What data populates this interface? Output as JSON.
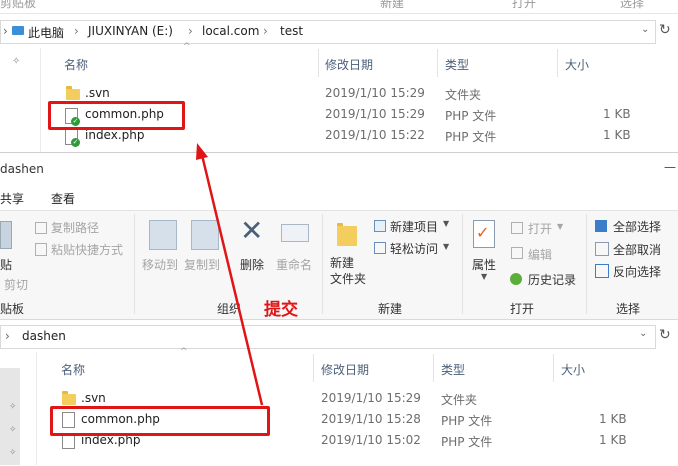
{
  "top_window": {
    "ribbon_tail": [
      "剪贴板",
      "新建",
      "打开",
      "选择"
    ],
    "breadcrumb": [
      "此电脑",
      "JIUXINYAN (E:)",
      "local.com",
      "test"
    ],
    "columns": [
      "名称",
      "修改日期",
      "类型",
      "大小"
    ],
    "files": [
      {
        "name": ".svn",
        "date": "2019/1/10 15:29",
        "type": "文件夹",
        "size": ""
      },
      {
        "name": "common.php",
        "date": "2019/1/10 15:29",
        "type": "PHP 文件",
        "size": "1 KB"
      },
      {
        "name": "index.php",
        "date": "2019/1/10 15:22",
        "type": "PHP 文件",
        "size": "1 KB"
      }
    ]
  },
  "bottom_window": {
    "title": "dashen",
    "tabs": [
      "共享",
      "查看"
    ],
    "ribbon": {
      "copy_path": "复制路径",
      "paste_shortcut": "粘贴快捷方式",
      "paste": "贴",
      "cut": "剪切",
      "clipboard_group": "贴板",
      "move_to": "移动到",
      "copy_to": "复制到",
      "delete": "删除",
      "rename": "重命名",
      "organize_group": "组织",
      "new_item": "新建项目",
      "easy_access": "轻松访问",
      "new_folder": "新建\n文件夹",
      "new_group": "新建",
      "properties": "属性",
      "open": "打开",
      "edit": "编辑",
      "history": "历史记录",
      "open_group": "打开",
      "select_all": "全部选择",
      "select_none": "全部取消",
      "invert_selection": "反向选择",
      "select_group": "选择"
    },
    "breadcrumb": [
      "dashen"
    ],
    "columns": [
      "名称",
      "修改日期",
      "类型",
      "大小"
    ],
    "files": [
      {
        "name": ".svn",
        "date": "2019/1/10 15:29",
        "type": "文件夹",
        "size": ""
      },
      {
        "name": "common.php",
        "date": "2019/1/10 15:28",
        "type": "PHP 文件",
        "size": "1 KB"
      },
      {
        "name": "index.php",
        "date": "2019/1/10 15:02",
        "type": "PHP 文件",
        "size": "1 KB"
      }
    ]
  },
  "annotation": {
    "label": "提交",
    "color": "#e01515"
  }
}
